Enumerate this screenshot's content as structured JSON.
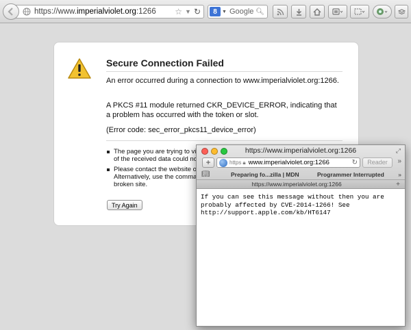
{
  "firefox": {
    "url_prefix": "https://www.",
    "url_host": "imperialviolet.org",
    "url_port": ":1266",
    "search_engine_badge": "8",
    "search_placeholder": "Google"
  },
  "error_page": {
    "title": "Secure Connection Failed",
    "intro": "An error occurred during a connection to www.imperialviolet.org:1266.",
    "detail": "A PKCS #11 module returned CKR_DEVICE_ERROR, indicating that a problem has occurred with the token or slot.",
    "code": "(Error code: sec_error_pkcs11_device_error)",
    "bullet1": "The page you are trying to vi",
    "bullet1_line2": "of the received data could no",
    "bullet2": "Please contact the website ow",
    "bullet2_line2": "Alternatively, use the comma",
    "bullet2_line3": "broken site.",
    "try_again_label": "Try Again"
  },
  "safari": {
    "window_title": "https://www.imperialviolet.org:1266",
    "https_label": "https",
    "address": "www.imperialviolet.org:1266",
    "reader_label": "Reader",
    "bookmarks": [
      "Preparing fo...zilla | MDN",
      "Programmer Interrupted"
    ],
    "tab_title": "https://www.imperialviolet.org:1266",
    "content": "If you can see this message without then you are\nprobably affected by CVE-2014-1266! See\nhttp://support.apple.com/kb/HT6147"
  },
  "colors": {
    "warning_yellow": "#f2c230",
    "light_red": "#fc5f57",
    "light_yellow": "#fdbc2e",
    "light_green": "#28c840"
  }
}
